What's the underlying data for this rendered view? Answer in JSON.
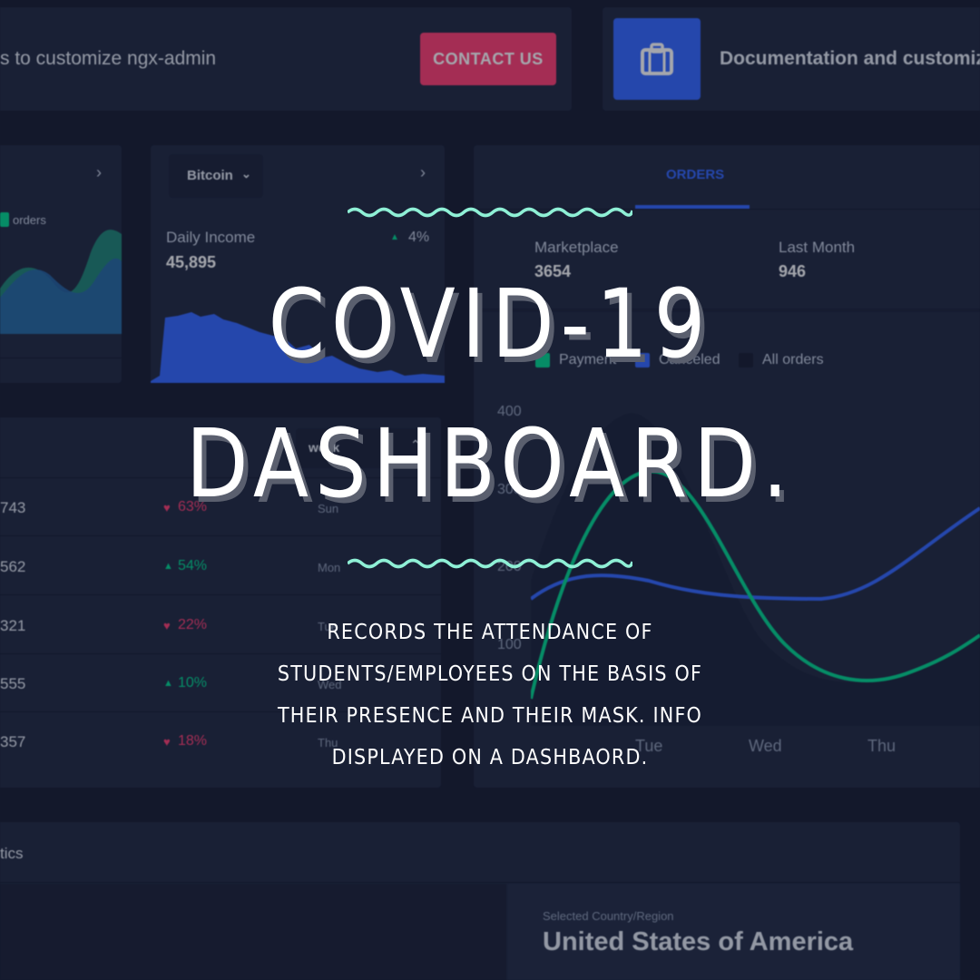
{
  "banner": {
    "text": "s to customize ngx-admin",
    "contact_label": "CONTACT US",
    "doc_text": "Documentation and customiza"
  },
  "left_widget": {
    "legend": "orders"
  },
  "income": {
    "select_value": "Bitcoin",
    "label": "Daily Income",
    "value": "45,895",
    "change": "4%"
  },
  "orders": {
    "tab": "ORDERS",
    "marketplace_label": "Marketplace",
    "marketplace_value": "3654",
    "last_month_label": "Last Month",
    "last_month_value": "946",
    "legend": [
      "Payment",
      "Canceled",
      "All orders"
    ],
    "y_ticks": [
      "400",
      "300",
      "200",
      "100"
    ],
    "x_ticks": [
      "Tue",
      "Wed",
      "Thu"
    ]
  },
  "table": {
    "select_value": "week",
    "rows": [
      {
        "value": "743",
        "change": "63%",
        "dir": "down",
        "day": "Sun"
      },
      {
        "value": "562",
        "change": "54%",
        "dir": "up",
        "day": "Mon"
      },
      {
        "value": "321",
        "change": "22%",
        "dir": "down",
        "day": "Tue"
      },
      {
        "value": "555",
        "change": "10%",
        "dir": "up",
        "day": "Wed"
      },
      {
        "value": "357",
        "change": "18%",
        "dir": "down",
        "day": "Thu"
      }
    ]
  },
  "stats": {
    "title": "tics",
    "country_label": "Selected Country/Region",
    "country": "United States of America"
  },
  "overlay": {
    "title_line1": "COVID-19",
    "title_line2": "DASHBOARD.",
    "description": "Records the attendance of students/employees on the basis of their presence and their mask. Info displayed on a dashbaord."
  },
  "colors": {
    "bg": "#151a30",
    "card": "#222b45",
    "danger": "#ff3d71",
    "primary": "#3366ff",
    "success": "#00d68f",
    "wave": "#8ff0d6"
  }
}
